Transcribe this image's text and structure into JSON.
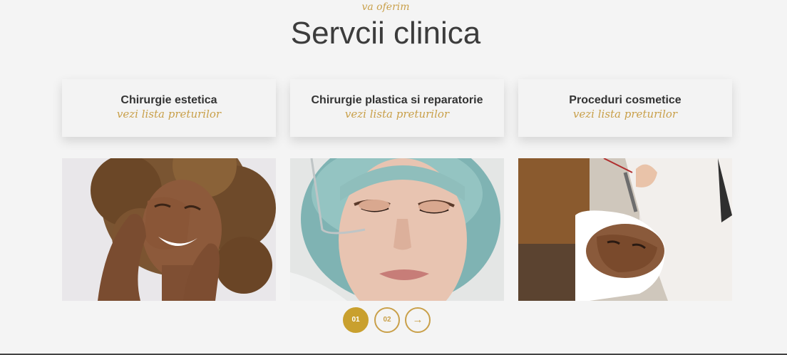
{
  "section": {
    "kicker": "va oferim",
    "title": "Servcii clinica"
  },
  "cards": [
    {
      "title": "Chirurgie estetica",
      "link": "vezi lista preturilor"
    },
    {
      "title": "Chirurgie plastica si reparatorie",
      "link": "vezi lista preturilor"
    },
    {
      "title": "Proceduri cosmetice",
      "link": "vezi lista preturilor"
    }
  ],
  "pagination": {
    "page1": "01",
    "page2": "02",
    "next": "→"
  },
  "colors": {
    "accent": "#c9a04a",
    "background": "#f4f4f4",
    "text": "#3c3c3c"
  }
}
